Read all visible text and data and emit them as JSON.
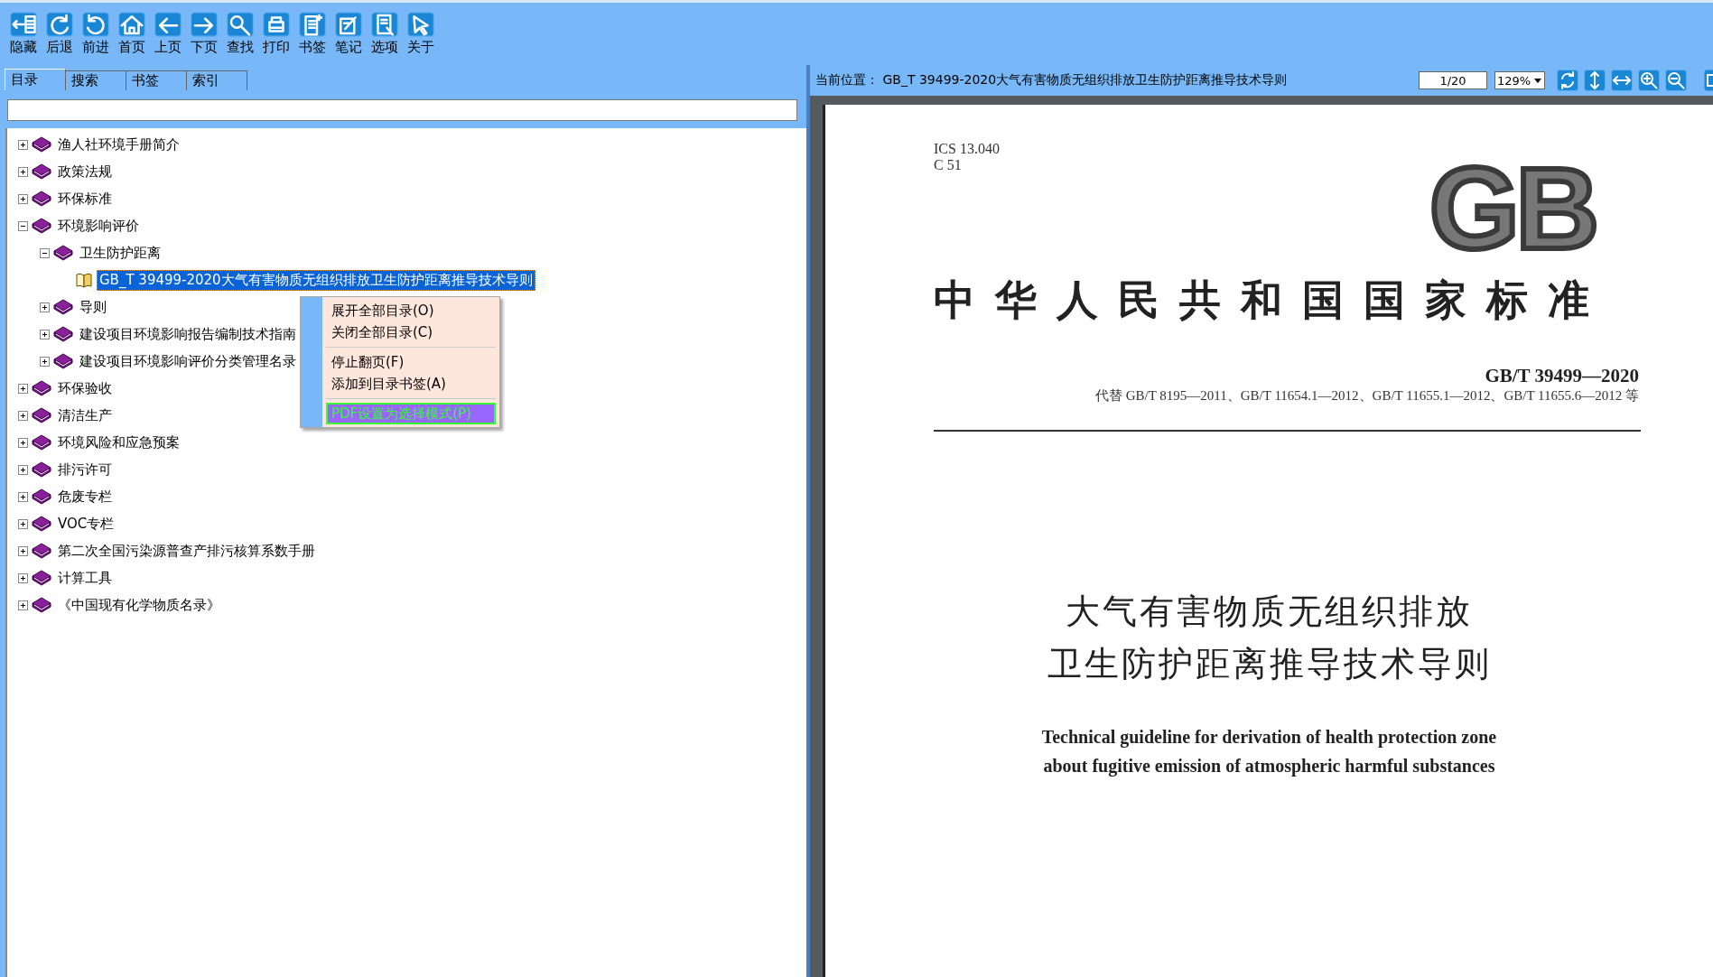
{
  "toolbar": [
    {
      "label": "隐藏"
    },
    {
      "label": "后退"
    },
    {
      "label": "前进"
    },
    {
      "label": "首页"
    },
    {
      "label": "上页"
    },
    {
      "label": "下页"
    },
    {
      "label": "查找"
    },
    {
      "label": "打印"
    },
    {
      "label": "书签"
    },
    {
      "label": "笔记"
    },
    {
      "label": "选项"
    },
    {
      "label": "关于"
    }
  ],
  "tabs": [
    {
      "label": "目录",
      "selected": true
    },
    {
      "label": "搜索",
      "selected": false
    },
    {
      "label": "书签",
      "selected": false
    },
    {
      "label": "索引",
      "selected": false
    }
  ],
  "tree": [
    {
      "kind": "folder",
      "label": "渔人社环境手册简介",
      "expanded": false,
      "selected": false
    },
    {
      "kind": "folder",
      "label": "政策法规",
      "expanded": false,
      "selected": false
    },
    {
      "kind": "folder",
      "label": "环保标准",
      "expanded": false,
      "selected": false
    },
    {
      "kind": "folder",
      "label": "环境影响评价",
      "expanded": true,
      "selected": false,
      "children": [
        {
          "kind": "folder",
          "label": "卫生防护距离",
          "expanded": true,
          "selected": false,
          "children": [
            {
              "kind": "document",
              "label": "GB_T 39499-2020大气有害物质无组织排放卫生防护距离推导技术导则",
              "selected": true
            }
          ]
        },
        {
          "kind": "folder",
          "label": "导则",
          "expanded": false,
          "selected": false
        },
        {
          "kind": "folder",
          "label": "建设项目环境影响报告编制技术指南",
          "expanded": false,
          "selected": false
        },
        {
          "kind": "folder",
          "label": "建设项目环境影响评价分类管理名录",
          "expanded": false,
          "selected": false
        }
      ]
    },
    {
      "kind": "folder",
      "label": "环保验收",
      "expanded": false,
      "selected": false
    },
    {
      "kind": "folder",
      "label": "清洁生产",
      "expanded": false,
      "selected": false
    },
    {
      "kind": "folder",
      "label": "环境风险和应急预案",
      "expanded": false,
      "selected": false
    },
    {
      "kind": "folder",
      "label": "排污许可",
      "expanded": false,
      "selected": false
    },
    {
      "kind": "folder",
      "label": "危废专栏",
      "expanded": false,
      "selected": false
    },
    {
      "kind": "folder",
      "label": "VOC专栏",
      "expanded": false,
      "selected": false
    },
    {
      "kind": "folder",
      "label": "第二次全国污染源普查产排污核算系数手册",
      "expanded": false,
      "selected": false
    },
    {
      "kind": "folder",
      "label": "计算工具",
      "expanded": false,
      "selected": false
    },
    {
      "kind": "folder",
      "label": "《中国现有化学物质名录》",
      "expanded": false,
      "selected": false
    }
  ],
  "context_menu": [
    {
      "kind": "item",
      "label": "展开全部目录(O)",
      "selected": false
    },
    {
      "kind": "item",
      "label": "关闭全部目录(C)",
      "selected": false
    },
    {
      "kind": "separator"
    },
    {
      "kind": "item",
      "label": "停止翻页(F)",
      "selected": false
    },
    {
      "kind": "item",
      "label": "添加到目录书签(A)",
      "selected": false
    },
    {
      "kind": "separator"
    },
    {
      "kind": "item",
      "label": "PDF设置为选择模式(P)",
      "selected": true
    }
  ],
  "viewer": {
    "location": "当前位置： GB_T 39499-2020大气有害物质无组织排放卫生防护距离推导技术导则",
    "page": "1/20",
    "zoom": "129%"
  },
  "document": {
    "ics": "ICS 13.040",
    "ccs": "C 51",
    "logo": "GB",
    "heading": "中华人民共和国国家标准",
    "number": "GB/T 39499—2020",
    "replaces": "代替 GB/T 8195—2011、GB/T 11654.1—2012、GB/T 11655.1—2012、GB/T 11655.6—2012 等",
    "title_lines": [
      "大气有害物质无组织排放",
      "卫生防护距离推导技术导则"
    ],
    "english_lines": [
      "Technical guideline for derivation of health protection zone",
      "about fugitive emission of atmospheric harmful substances"
    ]
  }
}
